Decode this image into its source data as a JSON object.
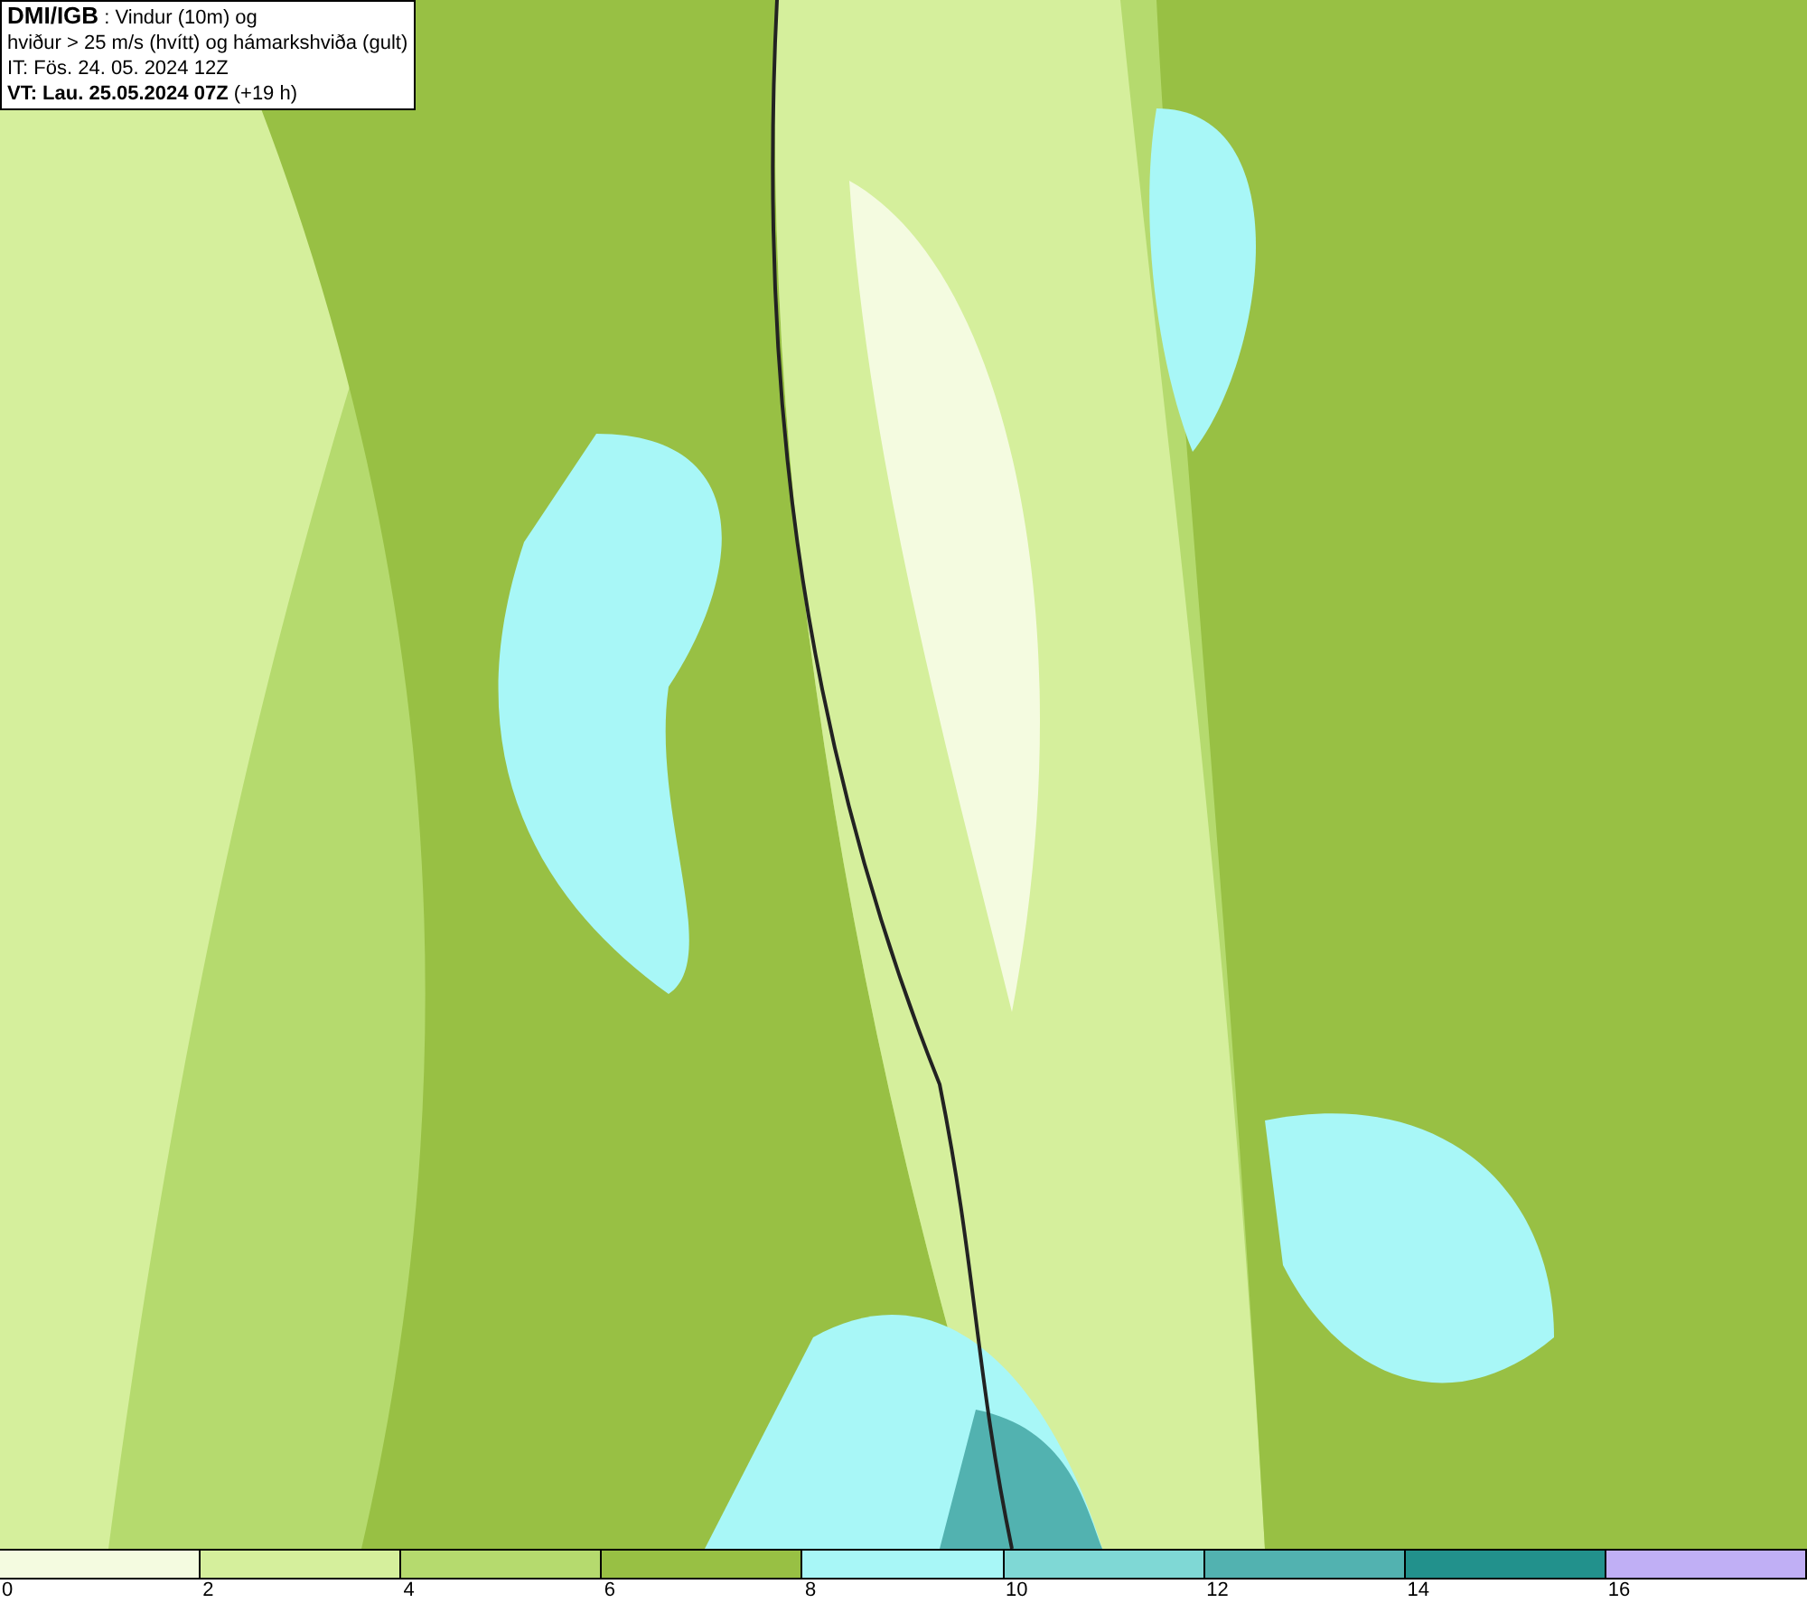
{
  "header": {
    "source": "DMI/IGB",
    "title_rest": " : Vindur (10m) og",
    "line_2": "hviður > 25 m/s (hvítt) og hámarkshviða (gult)",
    "initial_time": "IT: Fös. 24. 05. 2024 12Z",
    "valid_time": "VT: Lau. 25.05.2024 07Z",
    "lead": " (+19 h)"
  },
  "legend": {
    "bins": [
      {
        "color": "#f4fbe0"
      },
      {
        "color": "#d5ef9c"
      },
      {
        "color": "#b5da6e"
      },
      {
        "color": "#98c044"
      },
      {
        "color": "#a8f7f7"
      },
      {
        "color": "#7fd8d5"
      },
      {
        "color": "#52b2b0"
      },
      {
        "color": "#22918c"
      },
      {
        "color": "#c0aff5"
      }
    ],
    "ticks": [
      "0",
      "2",
      "4",
      "6",
      "8",
      "10",
      "12",
      "14",
      "16"
    ]
  }
}
